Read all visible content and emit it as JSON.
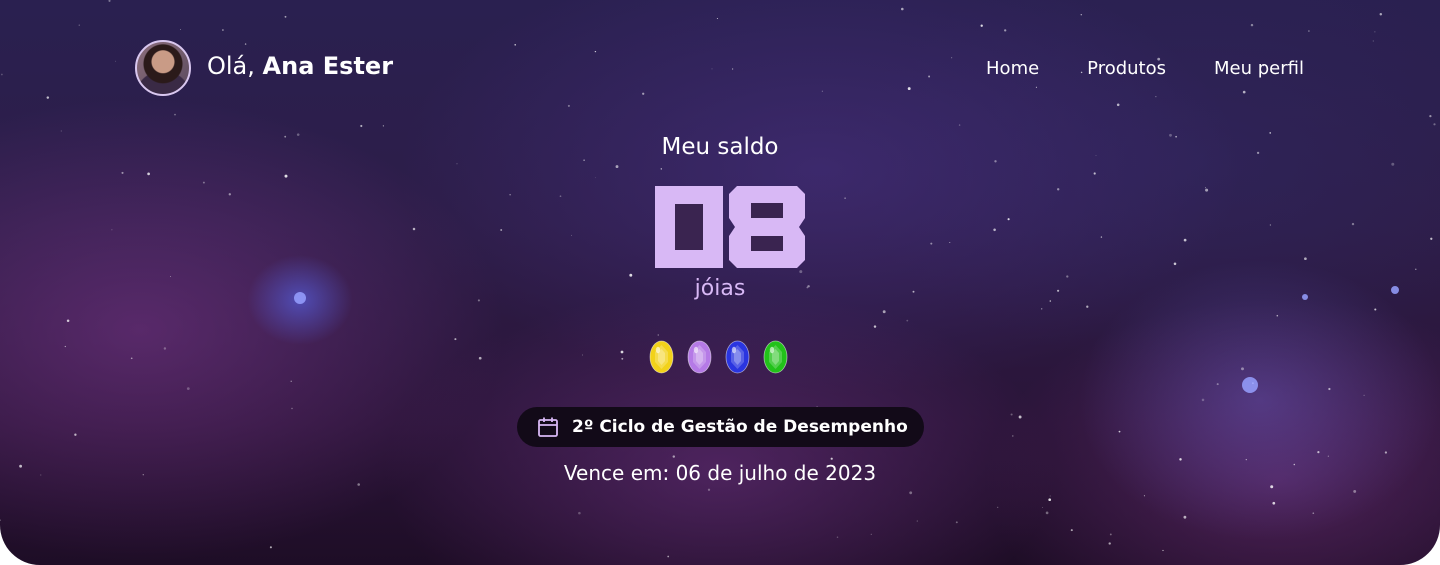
{
  "header": {
    "greeting_prefix": "Olá,",
    "user_name": "Ana Ester",
    "nav": [
      {
        "label": "Home"
      },
      {
        "label": "Produtos"
      },
      {
        "label": "Meu perfil"
      }
    ]
  },
  "balance": {
    "label": "Meu saldo",
    "value": "08",
    "unit": "jóias"
  },
  "gems": [
    {
      "name": "yellow-gem-icon",
      "color": "#f2d21a"
    },
    {
      "name": "purple-gem-icon",
      "color": "#b57ae6"
    },
    {
      "name": "blue-gem-icon",
      "color": "#2a35e0"
    },
    {
      "name": "green-gem-icon",
      "color": "#22c21a"
    }
  ],
  "cycle": {
    "icon": "calendar-icon",
    "label": "2º Ciclo de Gestão de Desempenho"
  },
  "due": {
    "text": "Vence em: 06 de julho de 2023"
  },
  "colors": {
    "accent": "#d8b8f5",
    "pill_bg": "#120a18"
  }
}
